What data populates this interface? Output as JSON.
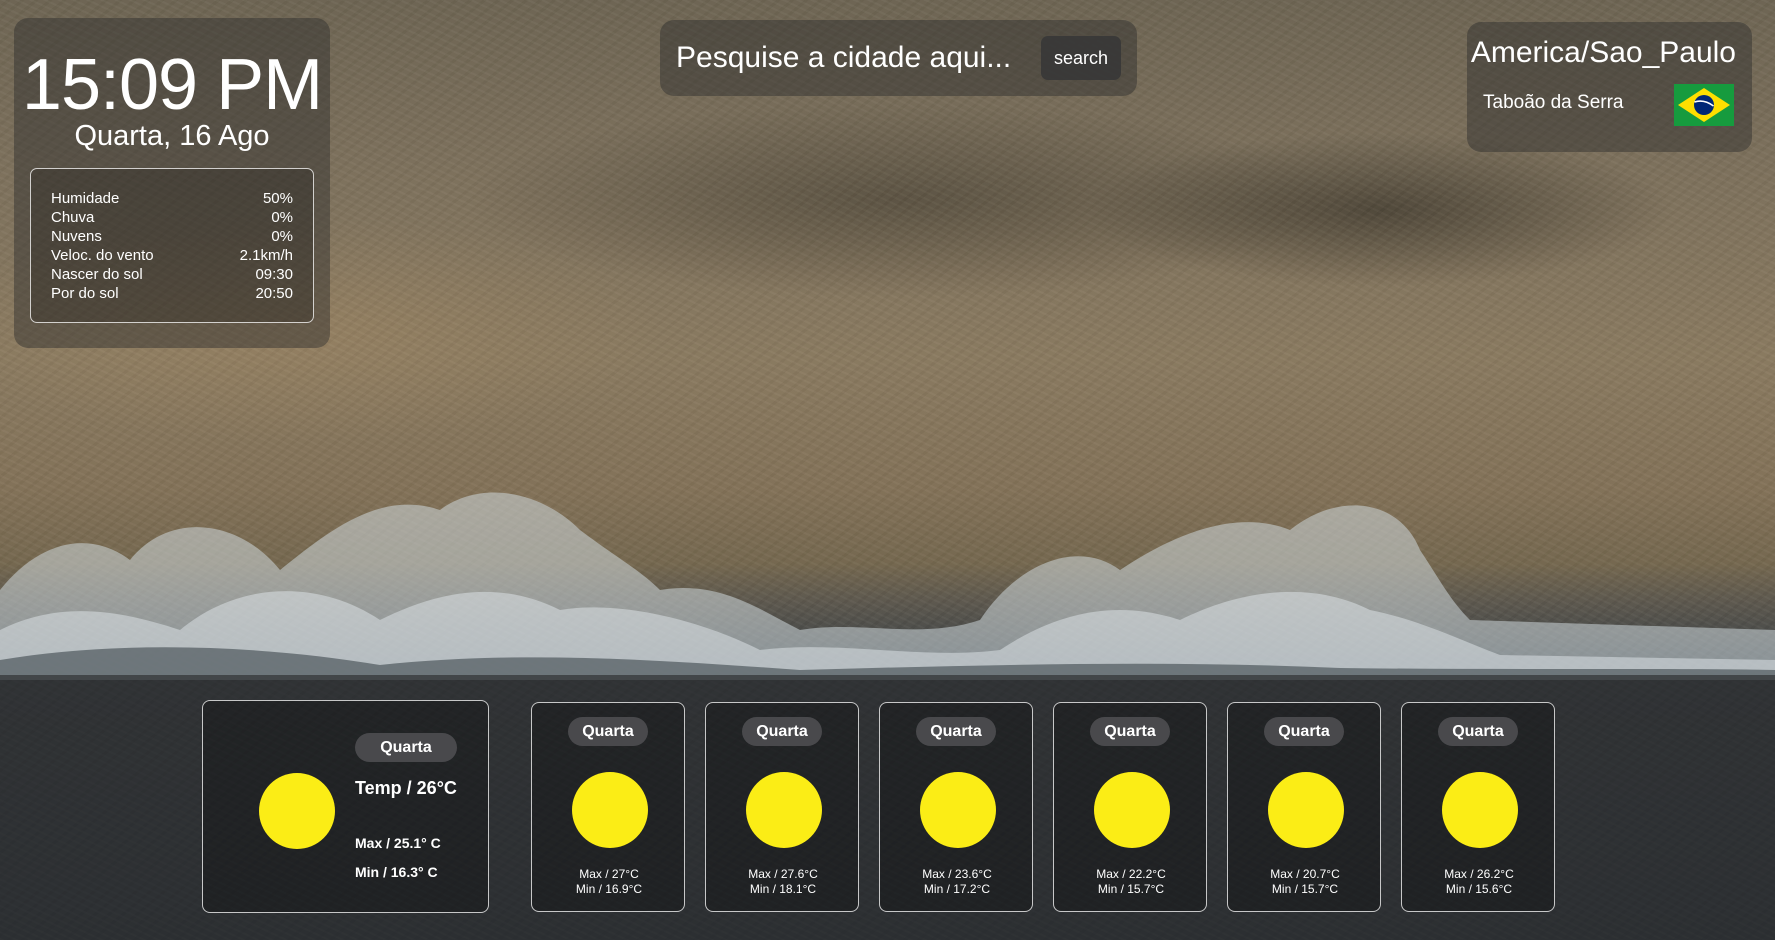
{
  "clock": {
    "time": "15:09 PM",
    "date": "Quarta, 16 Ago"
  },
  "details": [
    {
      "label": "Humidade",
      "value": "50%"
    },
    {
      "label": "Chuva",
      "value": "0%"
    },
    {
      "label": "Nuvens",
      "value": "0%"
    },
    {
      "label": "Veloc. do vento",
      "value": "2.1km/h"
    },
    {
      "label": "Nascer do sol",
      "value": "09:30"
    },
    {
      "label": "Por do sol",
      "value": "20:50"
    }
  ],
  "search": {
    "placeholder": "Pesquise a cidade aqui...",
    "button_label": "search"
  },
  "location": {
    "timezone": "America/Sao_Paulo",
    "city": "Taboão da Serra",
    "flag_icon": "brazil-flag-icon"
  },
  "today": {
    "day": "Quarta",
    "temp": "Temp / 26°C",
    "max": "Max / 25.1° C",
    "min": "Min / 16.3° C",
    "icon": "sun-icon"
  },
  "forecast": [
    {
      "day": "Quarta",
      "max": "Max / 27°C",
      "min": "Min / 16.9°C",
      "icon": "sun-icon"
    },
    {
      "day": "Quarta",
      "max": "Max / 27.6°C",
      "min": "Min / 18.1°C",
      "icon": "sun-icon"
    },
    {
      "day": "Quarta",
      "max": "Max / 23.6°C",
      "min": "Min / 17.2°C",
      "icon": "sun-icon"
    },
    {
      "day": "Quarta",
      "max": "Max / 22.2°C",
      "min": "Min / 15.7°C",
      "icon": "sun-icon"
    },
    {
      "day": "Quarta",
      "max": "Max / 20.7°C",
      "min": "Min / 15.7°C",
      "icon": "sun-icon"
    },
    {
      "day": "Quarta",
      "max": "Max / 26.2°C",
      "min": "Min / 15.6°C",
      "icon": "sun-icon"
    }
  ],
  "colors": {
    "sun": "#fbed16",
    "panel": "#2d2d2d"
  }
}
